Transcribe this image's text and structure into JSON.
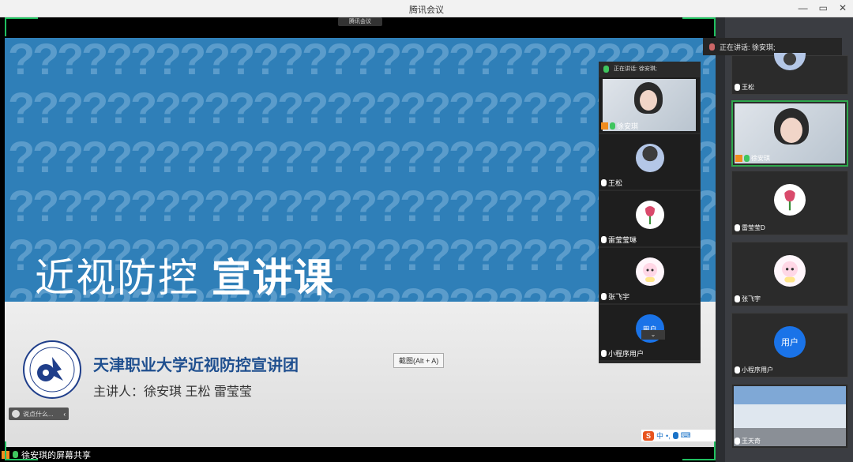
{
  "window": {
    "title": "腾讯会议",
    "minimize_glyph": "—",
    "restore_glyph": "▭",
    "close_glyph": "✕"
  },
  "indicator": {
    "label": "腾讯会议"
  },
  "slide": {
    "title_light": "近视防控",
    "title_bold": "宣讲课",
    "org": "天津职业大学近视防控宣讲团",
    "speakers": "主讲人：徐安琪 王松 雷莹莹",
    "pattern_glyph": "?",
    "pattern_color": "#5b9ccb"
  },
  "screenshot_tip": "截图(Alt + A)",
  "chat": {
    "placeholder": "说点什么...",
    "collapse_glyph": "‹"
  },
  "ime": {
    "brand": "S",
    "lang": "中",
    "punct": "•,",
    "extra": "⌨"
  },
  "share_label": "徐安琪的屏幕共享",
  "inner_panel": {
    "speaking": "正在讲话: 徐安琪;",
    "tiles": [
      {
        "name": "徐安琪",
        "kind": "camera"
      },
      {
        "name": "王松",
        "kind": "photo"
      },
      {
        "name": "雷莹莹琳",
        "kind": "tulip"
      },
      {
        "name": "张飞宇",
        "kind": "doll"
      },
      {
        "name": "小程序用户",
        "kind": "user",
        "avatar_text": "用户"
      }
    ],
    "more_glyph": "⌄"
  },
  "sidebar": {
    "speaking": "正在讲话: 徐安琪;",
    "tiles": [
      {
        "name": "王松",
        "kind": "photo"
      },
      {
        "name": "徐安琪",
        "kind": "camera",
        "active": true
      },
      {
        "name": "雷莹莹D",
        "kind": "tulip"
      },
      {
        "name": "张飞宇",
        "kind": "doll"
      },
      {
        "name": "小程序用户",
        "kind": "user",
        "avatar_text": "用户"
      },
      {
        "name": "王天奇",
        "kind": "room"
      }
    ]
  },
  "colors": {
    "accent_green": "#20c060",
    "slide_blue": "#2f7fb8",
    "org_blue": "#1f4f8f",
    "user_blue": "#1a73e8"
  }
}
